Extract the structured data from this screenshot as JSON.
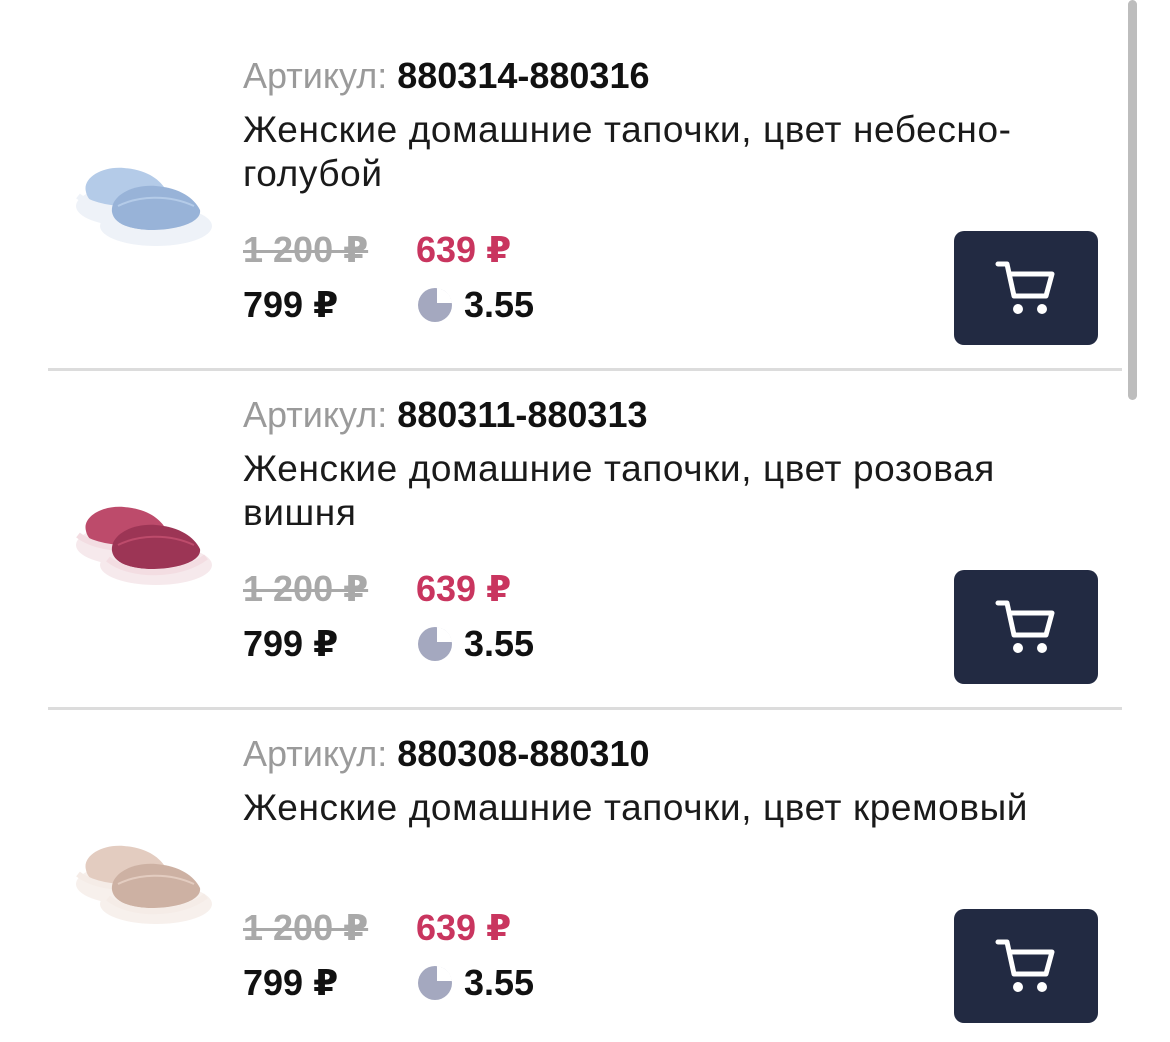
{
  "products": [
    {
      "sku_label": "Артикул:",
      "sku": "880314-880316",
      "title": "Женские домашние тапочки, цвет небесно-голубой",
      "old_price": "1 200 ₽",
      "promo_price": "639 ₽",
      "price": "799 ₽",
      "points": "3.55",
      "color": "#b4cbe8",
      "color_dark": "#98b3d8",
      "image_icon": "slippers-image",
      "cart_icon": "cart-icon"
    },
    {
      "sku_label": "Артикул:",
      "sku": "880311-880313",
      "title": "Женские домашние тапочки, цвет розовая вишня",
      "old_price": "1 200 ₽",
      "promo_price": "639 ₽",
      "price": "799 ₽",
      "points": "3.55",
      "color": "#bd4b6b",
      "color_dark": "#9c3555",
      "image_icon": "slippers-image",
      "cart_icon": "cart-icon"
    },
    {
      "sku_label": "Артикул:",
      "sku": "880308-880310",
      "title": "Женские домашние тапочки, цвет кремовый",
      "old_price": "1 200 ₽",
      "promo_price": "639 ₽",
      "price": "799 ₽",
      "points": "3.55",
      "color": "#e3ccc0",
      "color_dark": "#cdb1a3",
      "image_icon": "slippers-image",
      "cart_icon": "cart-icon"
    }
  ],
  "theme": {
    "accent_price_color": "#c9355f",
    "button_color": "#222a42",
    "points_icon_color": "#a4a8bf"
  }
}
